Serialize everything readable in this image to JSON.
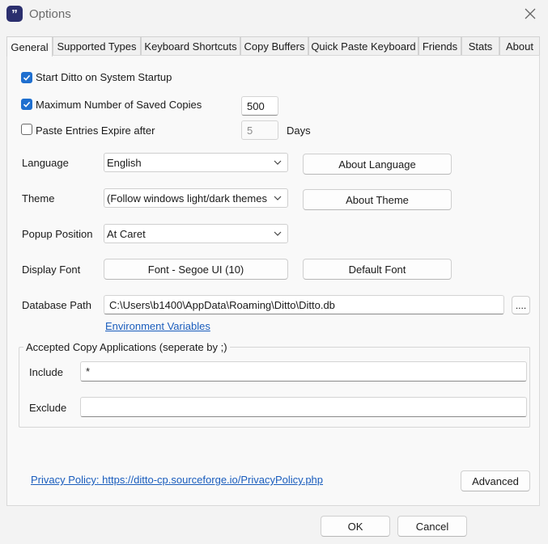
{
  "window": {
    "title": "Options",
    "app_icon_glyph": "”"
  },
  "tabs": [
    {
      "label": "General",
      "active": true
    },
    {
      "label": "Supported Types"
    },
    {
      "label": "Keyboard Shortcuts"
    },
    {
      "label": "Copy Buffers"
    },
    {
      "label": "Quick Paste Keyboard"
    },
    {
      "label": "Friends"
    },
    {
      "label": "Stats"
    },
    {
      "label": "About"
    }
  ],
  "general": {
    "start_on_startup": {
      "label": "Start Ditto on System Startup",
      "checked": true
    },
    "max_saved": {
      "label": "Maximum Number of Saved Copies",
      "checked": true,
      "value": "500"
    },
    "expire": {
      "label": "Paste Entries Expire after",
      "checked": false,
      "value": "5",
      "unit": "Days"
    },
    "language": {
      "label": "Language",
      "value": "English",
      "button": "About Language"
    },
    "theme": {
      "label": "Theme",
      "value": "(Follow windows light/dark themes",
      "button": "About Theme"
    },
    "popup": {
      "label": "Popup Position",
      "value": "At Caret"
    },
    "font": {
      "label": "Display Font",
      "button": "Font - Segoe UI (10)",
      "default_button": "Default Font"
    },
    "database": {
      "label": "Database Path",
      "value": "C:\\Users\\b1400\\AppData\\Roaming\\Ditto\\Ditto.db",
      "browse": "....",
      "env_link": "Environment Variables"
    },
    "accepted": {
      "title": "Accepted Copy Applications (seperate by ;)",
      "include_label": "Include",
      "include_value": "*",
      "exclude_label": "Exclude",
      "exclude_value": ""
    },
    "privacy_link": "Privacy Policy: https://ditto-cp.sourceforge.io/PrivacyPolicy.php",
    "advanced": "Advanced"
  },
  "footer": {
    "ok": "OK",
    "cancel": "Cancel"
  },
  "colors": {
    "accent": "#1f6fcf",
    "link": "#1a5dbd",
    "app_icon_bg": "#2b2f6e"
  }
}
